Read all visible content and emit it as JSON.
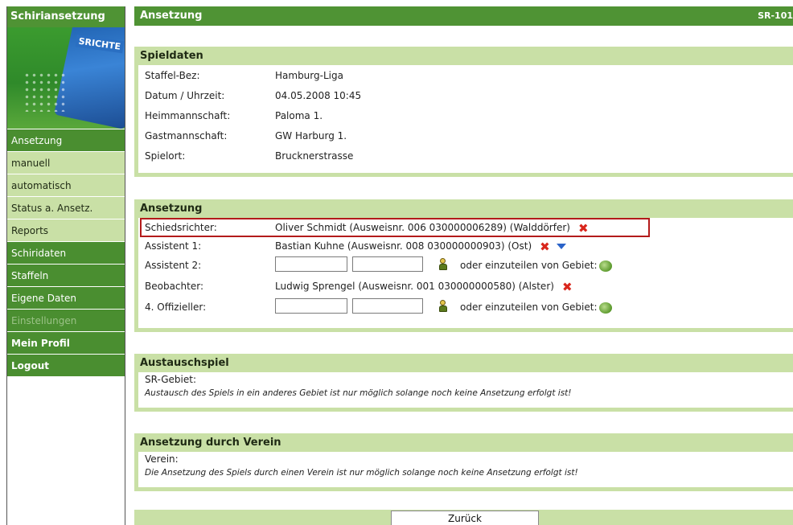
{
  "sidebar": {
    "title": "Schiriansetzung",
    "card_label": "SRICHTE",
    "items": [
      {
        "label": "Ansetzung"
      },
      {
        "label": "manuell"
      },
      {
        "label": "automatisch"
      },
      {
        "label": "Status a. Ansetz."
      },
      {
        "label": "Reports"
      },
      {
        "label": "Schiridaten"
      },
      {
        "label": "Staffeln"
      },
      {
        "label": "Eigene Daten"
      },
      {
        "label": "Einstellungen"
      },
      {
        "label": "Mein Profil"
      },
      {
        "label": "Logout"
      }
    ]
  },
  "header": {
    "title": "Ansetzung",
    "code": "SR-101"
  },
  "spieldaten": {
    "heading": "Spieldaten",
    "rows": [
      {
        "label": "Staffel-Bez:",
        "value": "Hamburg-Liga"
      },
      {
        "label": "Datum / Uhrzeit:",
        "value": "04.05.2008 10:45"
      },
      {
        "label": "Heimmannschaft:",
        "value": "Paloma 1."
      },
      {
        "label": "Gastmannschaft:",
        "value": "GW Harburg 1."
      },
      {
        "label": "Spielort:",
        "value": "Brucknerstrasse"
      }
    ]
  },
  "ansetzung": {
    "heading": "Ansetzung",
    "schiedsrichter": {
      "label": "Schiedsrichter:",
      "value": "Oliver Schmidt (Ausweisnr. 006 030000006289) (Walddörfer)"
    },
    "assistent1": {
      "label": "Assistent 1:",
      "value": "Bastian Kuhne (Ausweisnr. 008 030000000903) (Ost)"
    },
    "assistent2": {
      "label": "Assistent 2:",
      "field1": "",
      "field2": "",
      "alt_text": "oder einzuteilen von Gebiet:"
    },
    "beobachter": {
      "label": "Beobachter:",
      "value": "Ludwig Sprengel (Ausweisnr. 001 030000000580) (Alster)"
    },
    "offizieller4": {
      "label": "4. Offizieller:",
      "field1": "",
      "field2": "",
      "alt_text": "oder einzuteilen von Gebiet:"
    }
  },
  "austauschspiel": {
    "heading": "Austauschspiel",
    "label": "SR-Gebiet:",
    "note": "Austausch des Spiels in ein anderes Gebiet ist nur möglich solange noch keine Ansetzung erfolgt ist!"
  },
  "verein": {
    "heading": "Ansetzung durch Verein",
    "label": "Verein:",
    "note": "Die Ansetzung des Spiels durch einen Verein ist nur möglich solange noch keine Ansetzung erfolgt ist!"
  },
  "footer": {
    "back_label": "Zurück"
  },
  "colors": {
    "primary_green": "#4f9334",
    "light_green": "#c9e0a6",
    "delete_red": "#d9261c",
    "highlight_border": "#b31b1b"
  }
}
